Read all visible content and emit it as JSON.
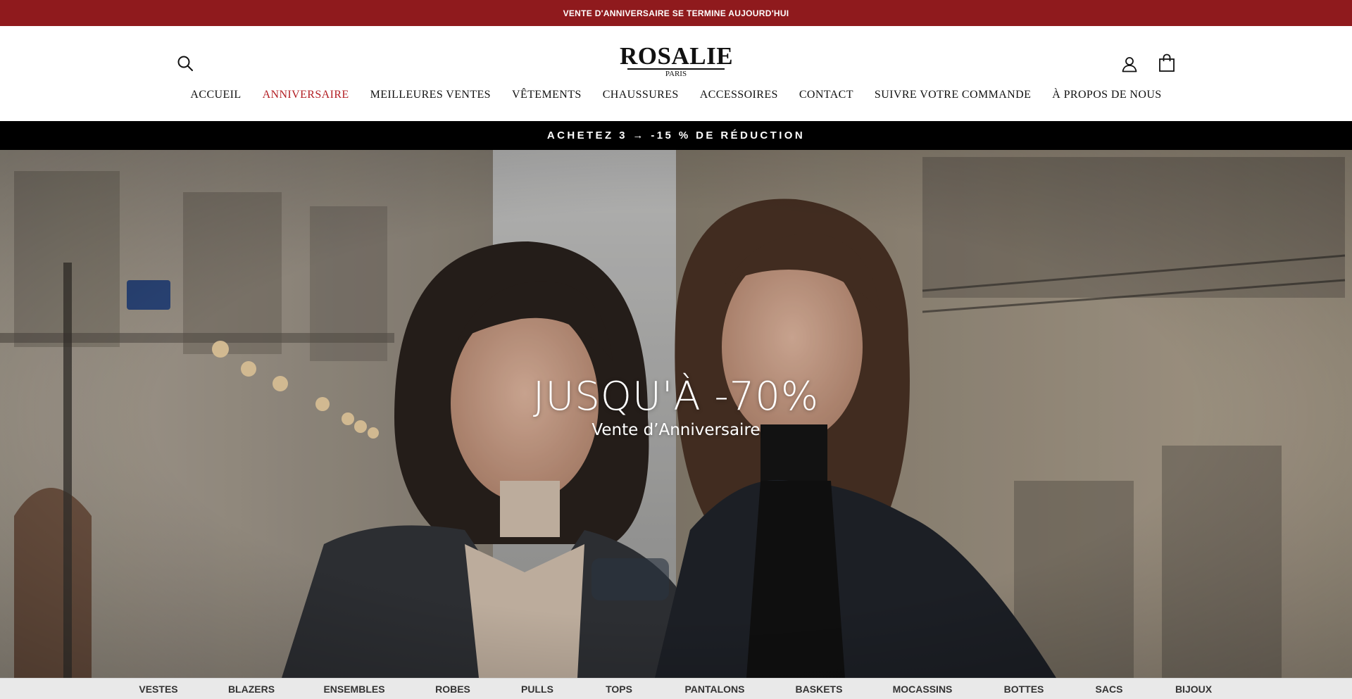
{
  "announcement": {
    "text": "VENTE D'ANNIVERSAIRE SE TERMINE AUJOURD'HUI"
  },
  "header": {
    "logo": {
      "wordmark": "ROSALIE",
      "subtitle": "PARIS"
    },
    "icons": {
      "search": "search-icon",
      "account": "account-icon",
      "cart": "shopping-bag-icon"
    }
  },
  "nav": {
    "items": [
      {
        "label": "ACCUEIL"
      },
      {
        "label": "ANNIVERSAIRE",
        "active": true
      },
      {
        "label": "MEILLEURES VENTES"
      },
      {
        "label": "VÊTEMENTS"
      },
      {
        "label": "CHAUSSURES"
      },
      {
        "label": "ACCESSOIRES"
      },
      {
        "label": "CONTACT"
      },
      {
        "label": "SUIVRE VOTRE COMMANDE"
      },
      {
        "label": "À PROPOS DE NOUS"
      }
    ]
  },
  "promo": {
    "text": "ACHETEZ 3 → -15 % DE RÉDUCTION"
  },
  "hero": {
    "headline": "JUSQU'À -70%",
    "subheadline": "Vente d’Anniversaire"
  },
  "categories": {
    "items": [
      {
        "label": "VESTES"
      },
      {
        "label": "BLAZERS"
      },
      {
        "label": "ENSEMBLES"
      },
      {
        "label": "ROBES"
      },
      {
        "label": "PULLS"
      },
      {
        "label": "TOPS"
      },
      {
        "label": "PANTALONS"
      },
      {
        "label": "BASKETS"
      },
      {
        "label": "MOCASSINS"
      },
      {
        "label": "BOTTES"
      },
      {
        "label": "SACS"
      },
      {
        "label": "BIJOUX"
      }
    ]
  },
  "colors": {
    "announcement_bg": "#8f1a1d",
    "nav_active": "#b21d22",
    "promo_bg": "#000000",
    "category_bar_bg": "#e9e9e9"
  }
}
